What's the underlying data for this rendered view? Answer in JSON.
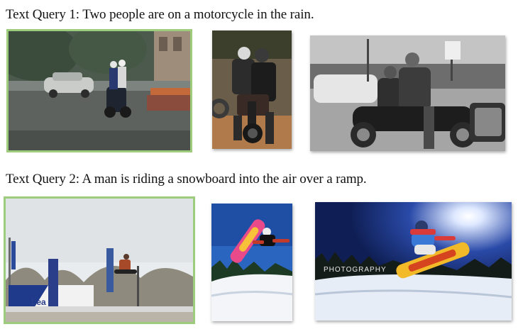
{
  "queries": [
    {
      "text": "Text Query 1: Two people are on a motorcycle in the rain.",
      "images": [
        {
          "subject": "two riders on a motorcycle on a rainy street",
          "highlighted": true
        },
        {
          "subject": "two riders in helmets on a motorcycle",
          "highlighted": false
        },
        {
          "subject": "two riders on a motorcycle, black and white",
          "highlighted": false
        }
      ]
    },
    {
      "text": "Text Query 2: A man is riding a snowboard into the air over a ramp.",
      "images": [
        {
          "subject": "snowboarder jumping over a ramp near a banner",
          "highlighted": true,
          "sign_text": "Lea"
        },
        {
          "subject": "snowboarder airborne with a pink board",
          "highlighted": false
        },
        {
          "subject": "snowboarder jumping against a bright sun",
          "highlighted": false,
          "watermark": "PHOTOGRAPHY"
        }
      ]
    }
  ],
  "colors": {
    "highlight_border": "#9ccc7c",
    "text": "#111111"
  }
}
